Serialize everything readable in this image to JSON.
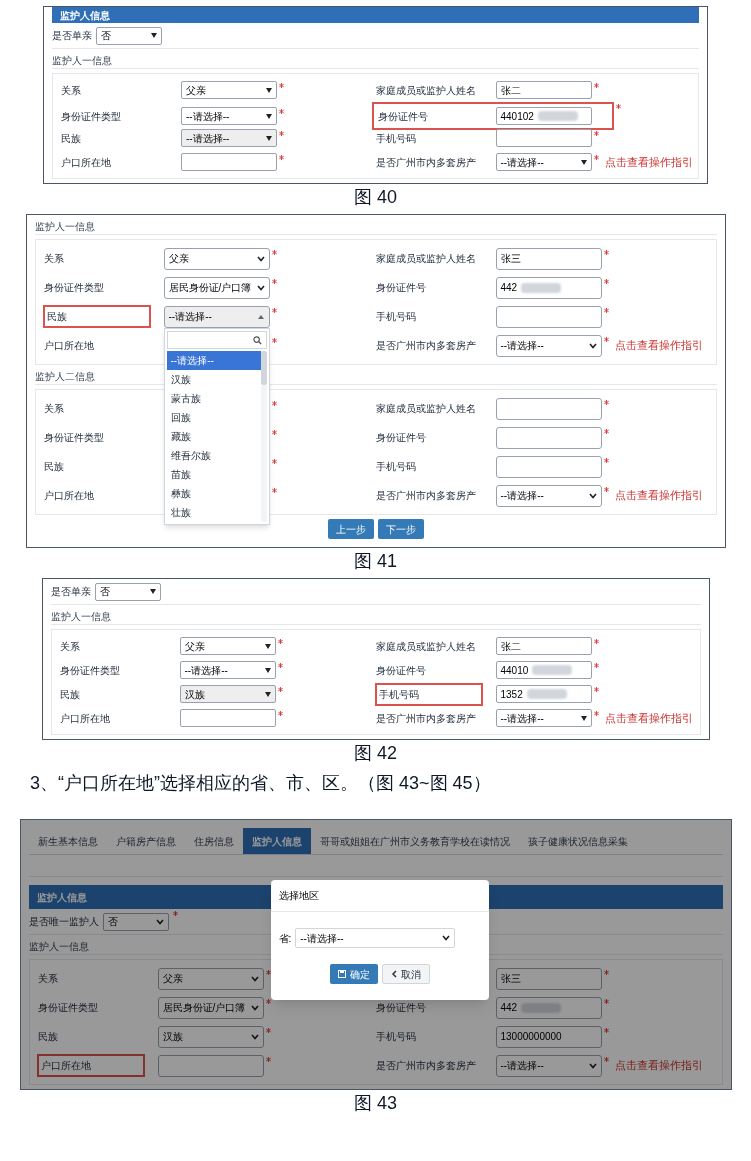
{
  "figures": [
    {
      "caption": "图 40",
      "header": "监护人信息",
      "single": {
        "label": "是否单亲",
        "value": "否"
      },
      "sections": [
        {
          "title": "监护人一信息",
          "rows": [
            [
              {
                "label": "关系",
                "kind": "select",
                "value": "父亲",
                "required": true
              },
              {
                "label": "家庭成员或监护人姓名",
                "kind": "input",
                "value": "张二",
                "required": true
              }
            ],
            [
              {
                "label": "身份证件类型",
                "kind": "select",
                "value": "--请选择--",
                "required": true
              },
              {
                "label": "身份证件号",
                "kind": "input",
                "value": "440102",
                "masked": true,
                "highlighted": true,
                "required": true
              }
            ],
            [
              {
                "label": "民族",
                "kind": "select-disabled",
                "value": "--请选择--",
                "required": true
              },
              {
                "label": "手机号码",
                "kind": "input",
                "required": true
              }
            ],
            [
              {
                "label": "户口所在地",
                "kind": "input",
                "required": true
              },
              {
                "label": "是否广州市内多套房产",
                "kind": "select",
                "value": "--请选择--",
                "required": true,
                "link": "点击查看操作指引"
              }
            ]
          ]
        }
      ]
    },
    {
      "caption": "图 41",
      "buttons": [
        "上一步",
        "下一步"
      ],
      "sections": [
        {
          "title": "监护人一信息",
          "rows": [
            [
              {
                "label": "关系",
                "kind": "select",
                "value": "父亲",
                "required": true
              },
              {
                "label": "家庭成员或监护人姓名",
                "kind": "input",
                "value": "张三",
                "required": true
              }
            ],
            [
              {
                "label": "身份证件类型",
                "kind": "select",
                "value": "居民身份证/户口簿",
                "required": true
              },
              {
                "label": "身份证件号",
                "kind": "input",
                "value": "442",
                "masked": true,
                "required": true
              }
            ],
            [
              {
                "label": "民族",
                "kind": "select-open",
                "value": "--请选择--",
                "highlighted": true,
                "required": true
              },
              {
                "label": "手机号码",
                "kind": "input",
                "required": true
              }
            ],
            [
              {
                "label": "户口所在地",
                "kind": "covered",
                "required": true
              },
              {
                "label": "是否广州市内多套房产",
                "kind": "select",
                "value": "--请选择--",
                "required": true,
                "link": "点击查看操作指引"
              }
            ]
          ],
          "dropdown": {
            "options": [
              {
                "label": "--请选择--",
                "selected": true
              },
              {
                "label": "汉族",
                "selected": false
              },
              {
                "label": "蒙古族",
                "selected": false
              },
              {
                "label": "回族",
                "selected": false
              },
              {
                "label": "藏族",
                "selected": false
              },
              {
                "label": "维吾尔族",
                "selected": false
              },
              {
                "label": "苗族",
                "selected": false
              },
              {
                "label": "彝族",
                "selected": false
              },
              {
                "label": "壮族",
                "selected": false
              }
            ]
          }
        },
        {
          "title": "监护人二信息",
          "rows": [
            [
              {
                "label": "关系",
                "kind": "covered",
                "required": true
              },
              {
                "label": "家庭成员或监护人姓名",
                "kind": "input",
                "required": true
              }
            ],
            [
              {
                "label": "身份证件类型",
                "kind": "covered",
                "required": true
              },
              {
                "label": "身份证件号",
                "kind": "input",
                "required": true
              }
            ],
            [
              {
                "label": "民族",
                "kind": "covered",
                "required": true
              },
              {
                "label": "手机号码",
                "kind": "input",
                "required": true
              }
            ],
            [
              {
                "label": "户口所在地",
                "kind": "covered",
                "required": true
              },
              {
                "label": "是否广州市内多套房产",
                "kind": "select",
                "value": "--请选择--",
                "required": true,
                "link": "点击查看操作指引"
              }
            ]
          ]
        }
      ]
    },
    {
      "caption": "图 42",
      "single": {
        "label": "是否单亲",
        "value": "否"
      },
      "sections": [
        {
          "title": "监护人一信息",
          "rows": [
            [
              {
                "label": "关系",
                "kind": "select",
                "value": "父亲",
                "required": true
              },
              {
                "label": "家庭成员或监护人姓名",
                "kind": "input",
                "value": "张二",
                "required": true
              }
            ],
            [
              {
                "label": "身份证件类型",
                "kind": "select",
                "value": "--请选择--",
                "required": true
              },
              {
                "label": "身份证件号",
                "kind": "input",
                "value": "44010",
                "masked": true,
                "required": true
              }
            ],
            [
              {
                "label": "民族",
                "kind": "select-disabled",
                "value": "汉族",
                "required": true
              },
              {
                "label": "手机号码",
                "kind": "input",
                "value": "1352",
                "masked": true,
                "highlighted": true,
                "required": true
              }
            ],
            [
              {
                "label": "户口所在地",
                "kind": "input",
                "required": true
              },
              {
                "label": "是否广州市内多套房产",
                "kind": "select",
                "value": "--请选择--",
                "required": true,
                "link": "点击查看操作指引"
              }
            ]
          ]
        }
      ]
    }
  ],
  "instruction": "3、“户口所在地”选择相应的省、市、区。（图 43~图 45）",
  "figure_43": {
    "caption": "图 43",
    "tabs": [
      {
        "label": "新生基本信息",
        "selected": false
      },
      {
        "label": "户籍房产信息",
        "selected": false
      },
      {
        "label": "住房信息",
        "selected": false
      },
      {
        "label": "监护人信息",
        "selected": true
      },
      {
        "label": "哥哥或姐姐在广州市义务教育学校在读情况",
        "selected": false
      },
      {
        "label": "孩子健康状况信息采集",
        "selected": false
      }
    ],
    "header": "监护人信息",
    "single": {
      "label": "是否唯一监护人",
      "value": "否",
      "required": true
    },
    "sections": [
      {
        "title": "监护人一信息",
        "rows": [
          [
            {
              "label": "关系",
              "kind": "select",
              "value": "父亲",
              "required": true
            },
            {
              "kind": "input",
              "value": "张三",
              "required": true
            }
          ],
          [
            {
              "label": "身份证件类型",
              "kind": "select",
              "value": "居民身份证/户口簿",
              "required": true
            },
            {
              "label": "身份证件号",
              "kind": "input",
              "value": "442",
              "masked": true,
              "required": true
            }
          ],
          [
            {
              "label": "民族",
              "kind": "select",
              "value": "汉族",
              "required": true
            },
            {
              "label": "手机号码",
              "kind": "input",
              "value": "13000000000",
              "required": true
            }
          ],
          [
            {
              "label": "户口所在地",
              "kind": "input",
              "highlighted": true,
              "required": true
            },
            {
              "label": "是否广州市内多套房产",
              "kind": "select",
              "value": "--请选择--",
              "required": true,
              "link": "点击查看操作指引"
            }
          ]
        ]
      }
    ],
    "modal": {
      "title": "选择地区",
      "field": {
        "label": "省:",
        "value": "--请选择--"
      },
      "buttons": [
        {
          "label": "确定",
          "kind": "primary"
        },
        {
          "label": "取消",
          "kind": "default"
        }
      ]
    }
  }
}
